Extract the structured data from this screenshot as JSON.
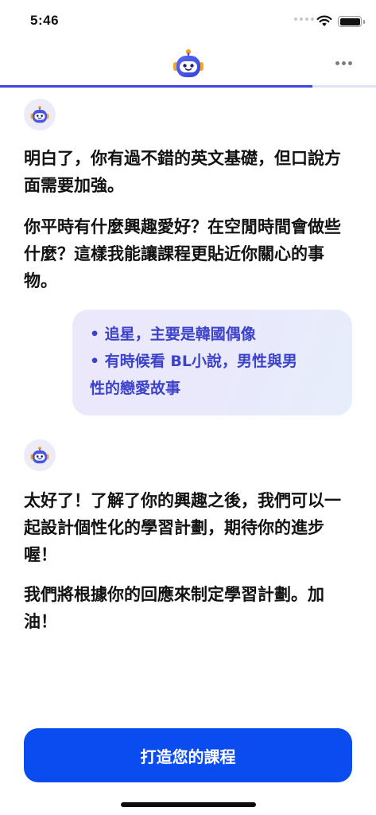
{
  "status_bar": {
    "time": "5:46"
  },
  "header": {
    "progress": 0.83
  },
  "messages": [
    {
      "role": "bot",
      "paragraphs": [
        "明白了，你有過不錯的英文基礎，但口說方面需要加強。",
        "你平時有什麼興趣愛好？在空閒時間會做些什麼？這樣我能讓課程更貼近你關心的事物。"
      ]
    },
    {
      "role": "user",
      "lines": [
        "• 追星，主要是韓國偶像",
        "• 有時候看 BL小說，男性與男",
        "性的戀愛故事"
      ]
    },
    {
      "role": "bot",
      "paragraphs": [
        "太好了！了解了你的興趣之後，我們可以一起設計個性化的學習計劃，期待你的進步喔！",
        "我們將根據你的回應來制定學習計劃。加油！"
      ]
    }
  ],
  "cta": {
    "label": "打造您的課程"
  },
  "colors": {
    "accent": "#0a4cf0",
    "progress": "#3f46e0",
    "bubble_text": "#3c42c9"
  }
}
